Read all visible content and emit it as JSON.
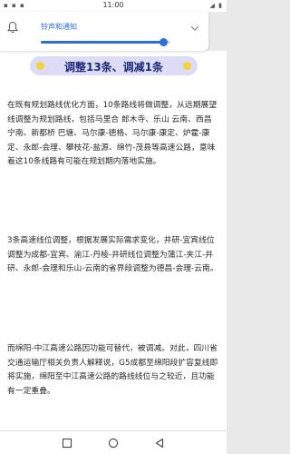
{
  "status_bar": {
    "time": "11:00",
    "left_icons": "▪ ▪ ▪",
    "right_icons": "◢ ▮"
  },
  "volume_panel": {
    "label": "铃声和通知",
    "level_percent": 0.95
  },
  "article": {
    "headline": "调整13条、调减1条",
    "paragraphs": [
      "在既有规划路线优化方面，10条路线将做调整，从远期展望线调整为规划路线，包括马里合 郎木寺、乐山 云南、西昌 宁南、新都桥 巴塘、马尔康-德格、马尔康-康定、炉霍-康定、永郎-会理、攀枝花-盐源、绵竹-茂县等高速公路，意味着这10条线路有可能在规划期内落地实施。",
      "3条高速线位调整，根据发展实际需求变化，井研-宜宾线位调整为成都-宜宾、渝江-丹棱-井研线位调整为蒲江-夹江-井研、永郎-会理和乐山-云南的省界段调整为德昌-会理-云南。",
      "而绵阳-中江高速公路因功能可替代，被调减。对此，四川省交通运输厅相关负责人解释说，G5成都至绵阳段扩容复线即将实施，绵阳至中江高速公路的路线线位与之较近，且功能有一定重叠。"
    ]
  },
  "colors": {
    "accent": "#2d6fd6",
    "banner_bg": "#dcdcf7",
    "banner_text": "#1e2a7a",
    "banner_dot": "#f5d23c"
  },
  "icons": {
    "volume": "bell-icon",
    "expand": "chevron-down-icon",
    "nav_back": "back-triangle-icon",
    "nav_home": "home-circle-icon",
    "nav_recent": "recent-square-icon"
  }
}
